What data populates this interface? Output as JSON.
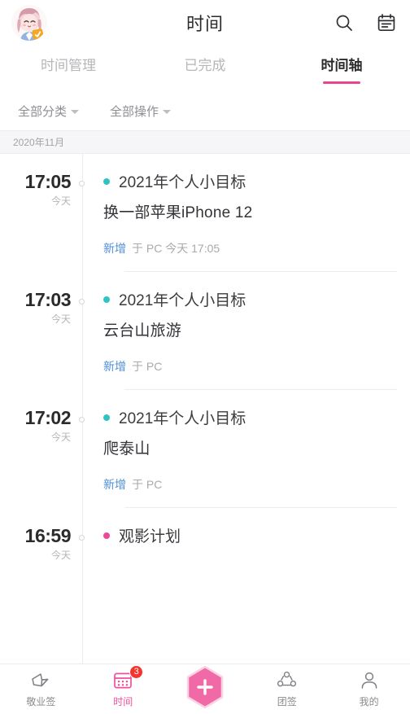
{
  "topbar": {
    "title": "时间",
    "avatar_name": "user-avatar",
    "search_icon": "search-icon",
    "calendar_icon": "calendar-icon"
  },
  "tabs": [
    {
      "label": "时间管理",
      "active": false
    },
    {
      "label": "已完成",
      "active": false
    },
    {
      "label": "时间轴",
      "active": true
    }
  ],
  "filters": [
    {
      "label": "全部分类"
    },
    {
      "label": "全部操作"
    }
  ],
  "date_strip": {
    "label": "2020年11月"
  },
  "entries": [
    {
      "time": "17:05",
      "day": "今天",
      "category": "2021年个人小目标",
      "dot_color": "#2ec4c4",
      "title": "换一部苹果iPhone 12",
      "action": "新增",
      "meta": "于 PC 今天 17:05"
    },
    {
      "time": "17:03",
      "day": "今天",
      "category": "2021年个人小目标",
      "dot_color": "#2ec4c4",
      "title": "云台山旅游",
      "action": "新增",
      "meta": "于 PC"
    },
    {
      "time": "17:02",
      "day": "今天",
      "category": "2021年个人小目标",
      "dot_color": "#2ec4c4",
      "title": "爬泰山",
      "action": "新增",
      "meta": "于 PC"
    },
    {
      "time": "16:59",
      "day": "今天",
      "category": "观影计划",
      "dot_color": "#ec4899",
      "title": "",
      "action": "",
      "meta": ""
    }
  ],
  "bottomnav": {
    "items": [
      {
        "label": "敬业签",
        "icon": "note-icon",
        "active": false,
        "badge": ""
      },
      {
        "label": "时间",
        "icon": "calendar-icon",
        "active": true,
        "badge": "3"
      },
      {
        "label": "团签",
        "icon": "team-icon",
        "active": false,
        "badge": ""
      },
      {
        "label": "我的",
        "icon": "person-icon",
        "active": false,
        "badge": ""
      }
    ],
    "add_button": {
      "label": "+",
      "name": "add-button"
    }
  },
  "colors": {
    "accent_pink": "#f0509b",
    "tab_underline": "#e8468c",
    "link_blue": "#4f8fd6",
    "badge_red": "#f5352c",
    "teal": "#2ec4c4"
  }
}
